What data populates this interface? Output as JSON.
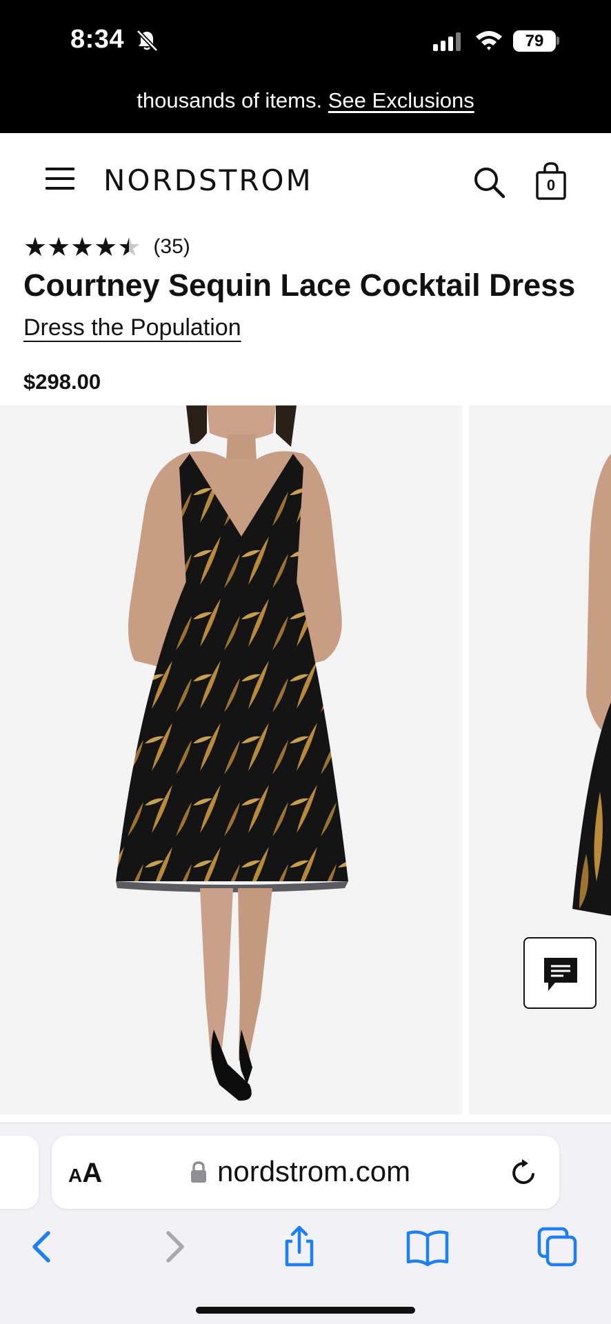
{
  "status_bar": {
    "time": "8:34",
    "battery": "79"
  },
  "promo": {
    "text": "thousands of items.",
    "link": "See Exclusions"
  },
  "header": {
    "brand": "NORDSTROM",
    "bag_count": "0"
  },
  "product": {
    "rating": 4.5,
    "review_count": "(35)",
    "title": "Courtney Sequin Lace Cocktail Dress",
    "brand": "Dress the Population",
    "price": "$298.00"
  },
  "browser": {
    "reader_small": "A",
    "reader_large": "A",
    "url": "nordstrom.com"
  },
  "colors": {
    "status_bar_bg": "#000000",
    "text": "#111111",
    "safari_blue": "#1d7ff5",
    "image_bg": "#f3f3f3",
    "dress_gold": "#b88a3a"
  },
  "icons": {
    "status": [
      "bell-slash-icon",
      "signal-icon",
      "wifi-icon"
    ],
    "header": [
      "hamburger-menu-icon",
      "search-icon",
      "shopping-bag-icon"
    ],
    "page": [
      "chat-icon"
    ],
    "browser": [
      "lock-icon",
      "reload-icon",
      "back-icon",
      "forward-icon",
      "share-icon",
      "bookmarks-icon",
      "tabs-icon"
    ]
  }
}
